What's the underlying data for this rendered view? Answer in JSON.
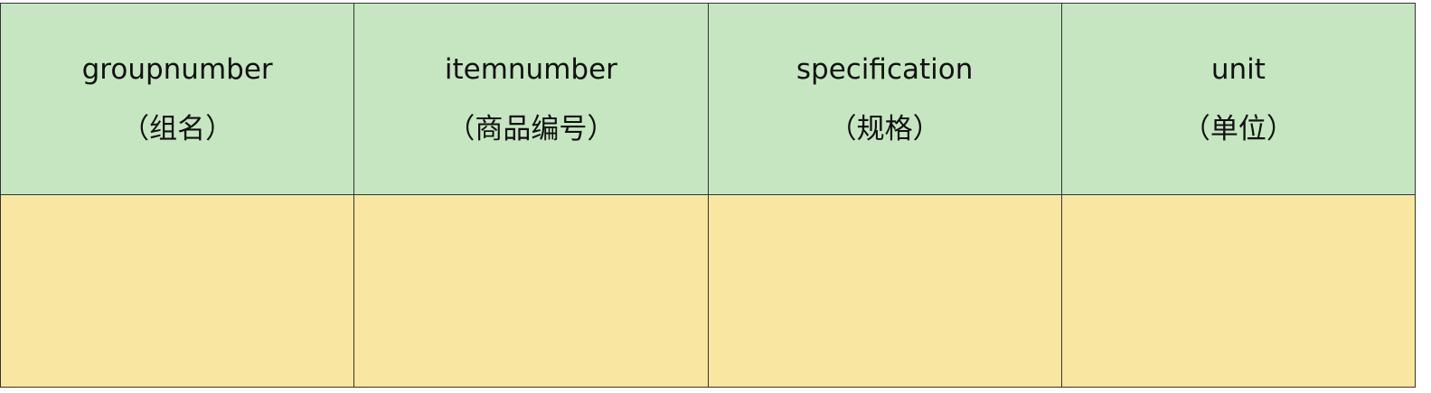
{
  "table": {
    "header_bg": "#c6e6c1",
    "row_bg": "#f9e7a1",
    "columns": [
      {
        "name": "groupnumber",
        "cn": "（组名）"
      },
      {
        "name": "itemnumber",
        "cn": "（商品编号）"
      },
      {
        "name": "specification",
        "cn": "（规格）"
      },
      {
        "name": "unit",
        "cn": "（单位）"
      }
    ],
    "rows": [
      [
        "",
        "",
        "",
        ""
      ]
    ]
  }
}
